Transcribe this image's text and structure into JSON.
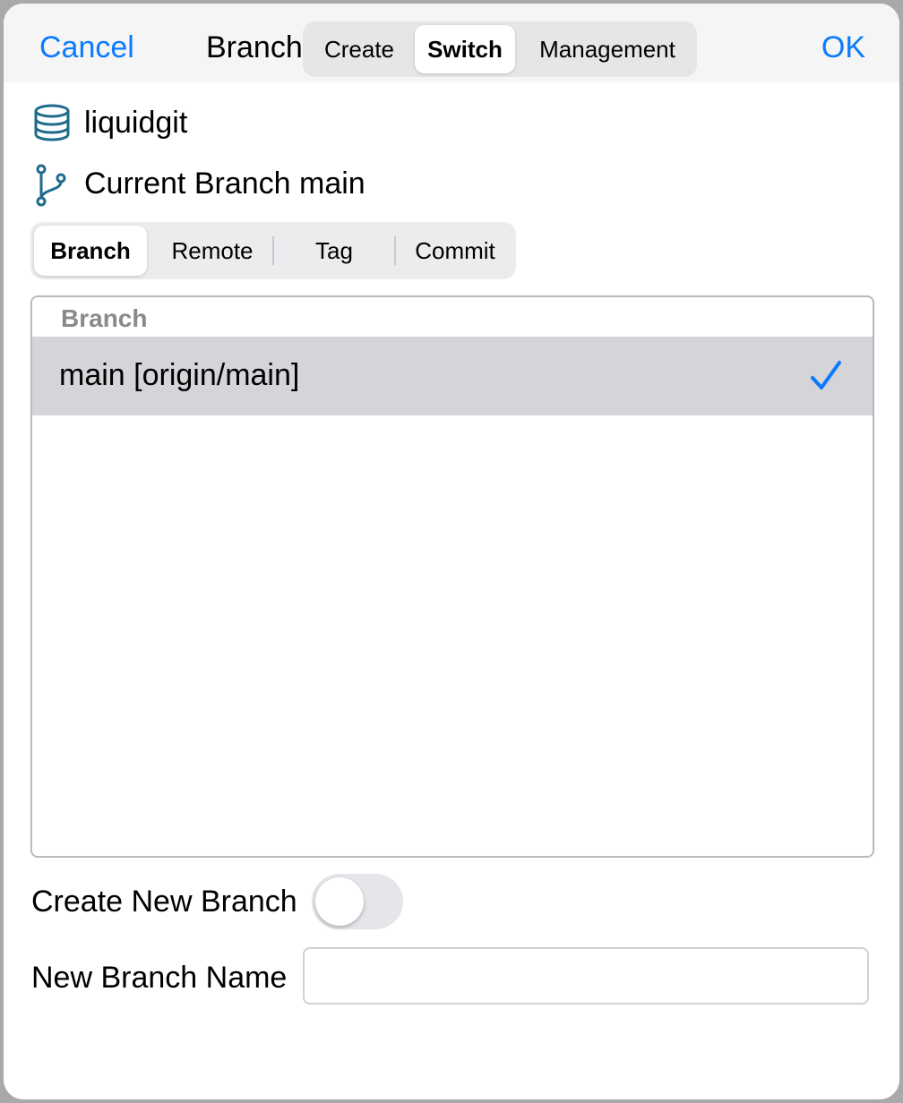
{
  "navbar": {
    "cancel_label": "Cancel",
    "title": "Branch",
    "ok_label": "OK",
    "modes": [
      "Create",
      "Switch",
      "Management"
    ],
    "active_mode": "Switch"
  },
  "repo": {
    "name": "liquidgit",
    "current_branch_text": "Current Branch main"
  },
  "ref_types": {
    "tabs": [
      "Branch",
      "Remote",
      "Tag",
      "Commit"
    ],
    "active": "Branch"
  },
  "branch_list": {
    "header": "Branch",
    "items": [
      {
        "label": "main [origin/main]",
        "selected": true
      }
    ]
  },
  "create_new": {
    "label": "Create New Branch",
    "enabled": false
  },
  "new_branch": {
    "label": "New Branch Name",
    "value": "",
    "placeholder": ""
  },
  "colors": {
    "accent": "#0a7aff",
    "icon": "#1e6b8c",
    "selected_row": "#d4d4d9"
  }
}
